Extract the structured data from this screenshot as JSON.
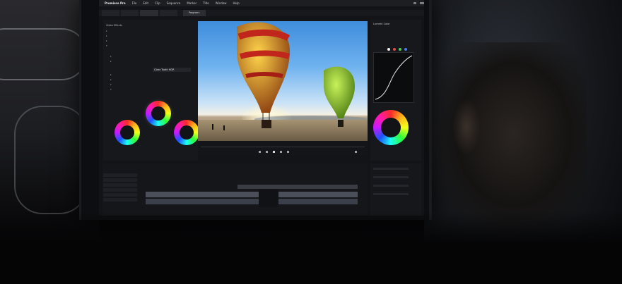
{
  "menubar": {
    "app_name": "Premiere Pro",
    "menus": [
      "File",
      "Edit",
      "Clip",
      "Sequence",
      "Marker",
      "Title",
      "Window",
      "Help"
    ]
  },
  "panels": {
    "program_label": "Program:",
    "effects_title": "Video Effects",
    "lumetri_title": "Lumetri Color"
  },
  "lumetri": {
    "preset_value": "Clear Tooth HDR"
  },
  "colors": {
    "accent_timecode": "#3d8bff",
    "panel_bg": "#17181c"
  },
  "icons": [
    "play-icon",
    "step-back-icon",
    "step-forward-icon",
    "settings-icon"
  ]
}
